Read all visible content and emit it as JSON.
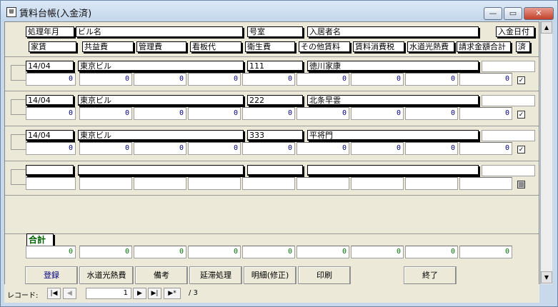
{
  "window": {
    "title": "賃料台帳(入金済)",
    "icon": "form-icon"
  },
  "headers": {
    "row1": [
      "処理年月",
      "ビル名",
      "号室",
      "入居者名",
      "入金日付"
    ],
    "row2": [
      "家賃",
      "共益費",
      "管理費",
      "看板代",
      "衛生費",
      "その他賃料",
      "賃料消費税",
      "水道光熱費",
      "請求金額合計",
      "済"
    ]
  },
  "records": [
    {
      "ym": "14/04",
      "building": "東京ビル",
      "room": "111",
      "tenant": "徳川家康",
      "paid_date": "",
      "amounts": [
        "0",
        "0",
        "0",
        "0",
        "0",
        "0",
        "0",
        "0",
        "0"
      ],
      "done": true,
      "done_mark": "✓"
    },
    {
      "ym": "14/04",
      "building": "東京ビル",
      "room": "222",
      "tenant": "北条早雲",
      "paid_date": "",
      "amounts": [
        "0",
        "0",
        "0",
        "0",
        "0",
        "0",
        "0",
        "0",
        "0"
      ],
      "done": true,
      "done_mark": "✓"
    },
    {
      "ym": "14/04",
      "building": "東京ビル",
      "room": "333",
      "tenant": "平将門",
      "paid_date": "",
      "amounts": [
        "0",
        "0",
        "0",
        "0",
        "0",
        "0",
        "0",
        "0",
        "0"
      ],
      "done": true,
      "done_mark": "✓"
    }
  ],
  "new_row": {
    "done_mark": "▩"
  },
  "totals": {
    "label": "合計",
    "values": [
      "0",
      "0",
      "0",
      "0",
      "0",
      "0",
      "0",
      "0",
      "0"
    ]
  },
  "buttons": {
    "register": "登録",
    "utilities": "水道光熱費",
    "notes": "備考",
    "late": "延滞処理",
    "detail": "明細(修正)",
    "print": "印刷",
    "exit": "終了"
  },
  "nav": {
    "label": "レコード:",
    "current": "1",
    "total": "/ 3"
  },
  "colors": {
    "title_bg": "#c2d5ea",
    "client_bg": "#ece9d8",
    "amount_blue": "#000080",
    "total_green": "#007000",
    "goukei_green": "#006400"
  }
}
